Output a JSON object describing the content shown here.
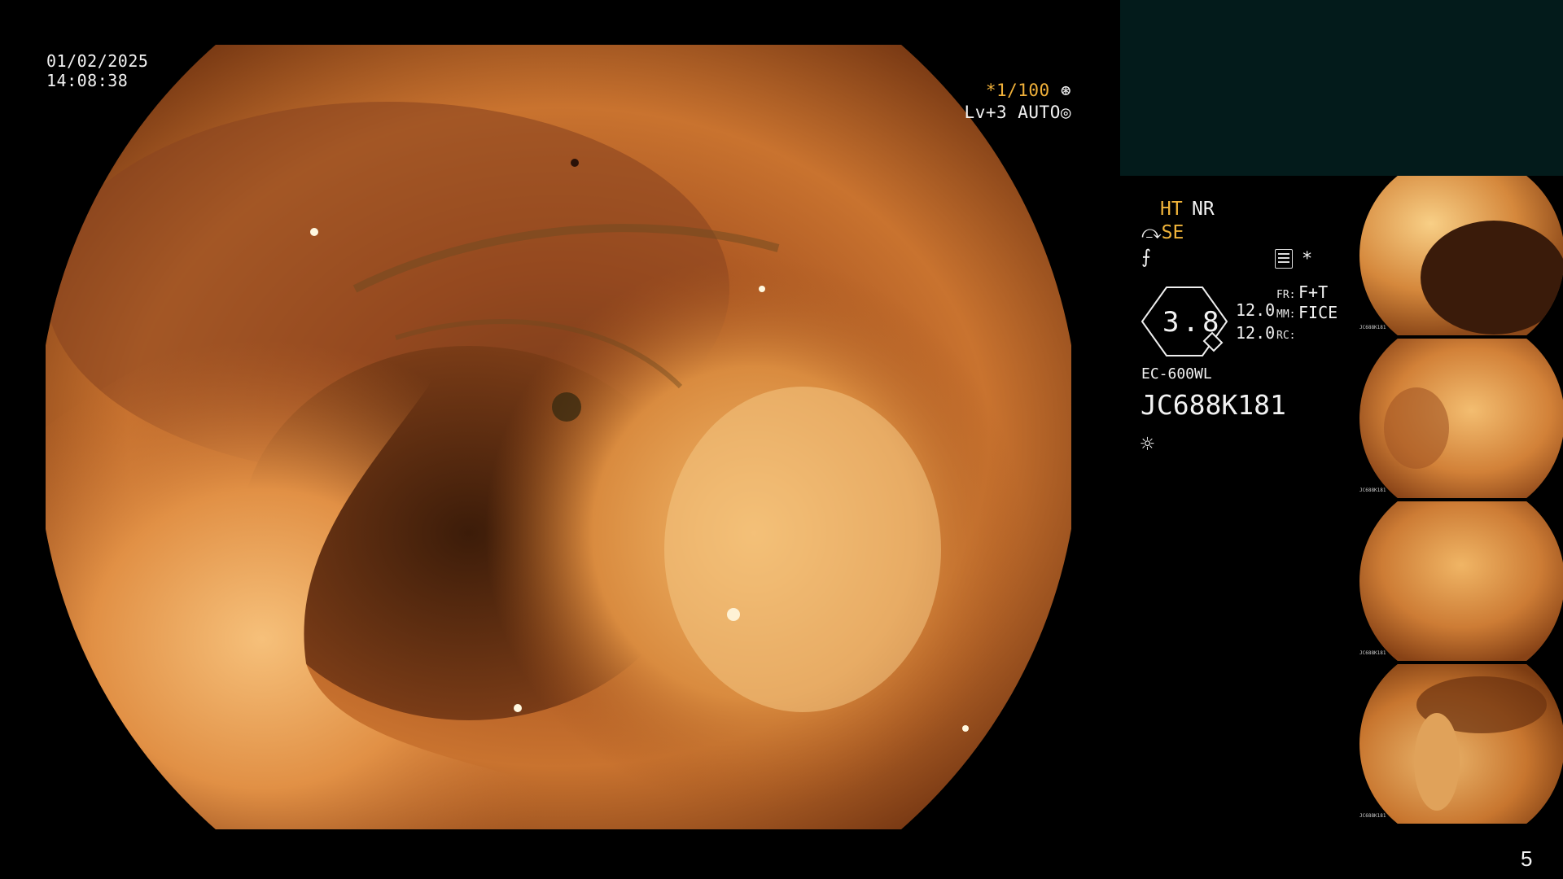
{
  "overlay": {
    "date": "01/02/2025",
    "time": "14:08:38",
    "shutter_prefix": "*",
    "shutter": "1/100",
    "shutter_icon": "aperture-icon",
    "level": "Lv+3 AUTO",
    "level_icon": "iris-icon"
  },
  "side_panel": {
    "ht": "HT",
    "nr": "NR",
    "se": "SE",
    "se_icon": "structure-enhance-icon",
    "hook_icon": "color-icon",
    "video_icon": "recording-icon",
    "star": "*",
    "zoom": "3.8",
    "value1": "12.0",
    "value2": "12.0",
    "fr_label": "FR:",
    "fr_value": "F+T",
    "mm_label": "MM:",
    "mm_value": "FICE",
    "rc_label": "RC:",
    "scope_model": "EC-600WL",
    "scope_serial": "JC688K181",
    "light_icon": "light-source-icon"
  },
  "thumbnails": [
    {
      "caption": "JC688K181"
    },
    {
      "caption": "JC688K181"
    },
    {
      "caption": "JC688K181"
    },
    {
      "caption": "JC688K181"
    }
  ],
  "colors": {
    "overlay_orange": "#f1b13a",
    "panel_teal": "#031b1b",
    "mucosa": "#d9893e"
  },
  "page_number": "5"
}
